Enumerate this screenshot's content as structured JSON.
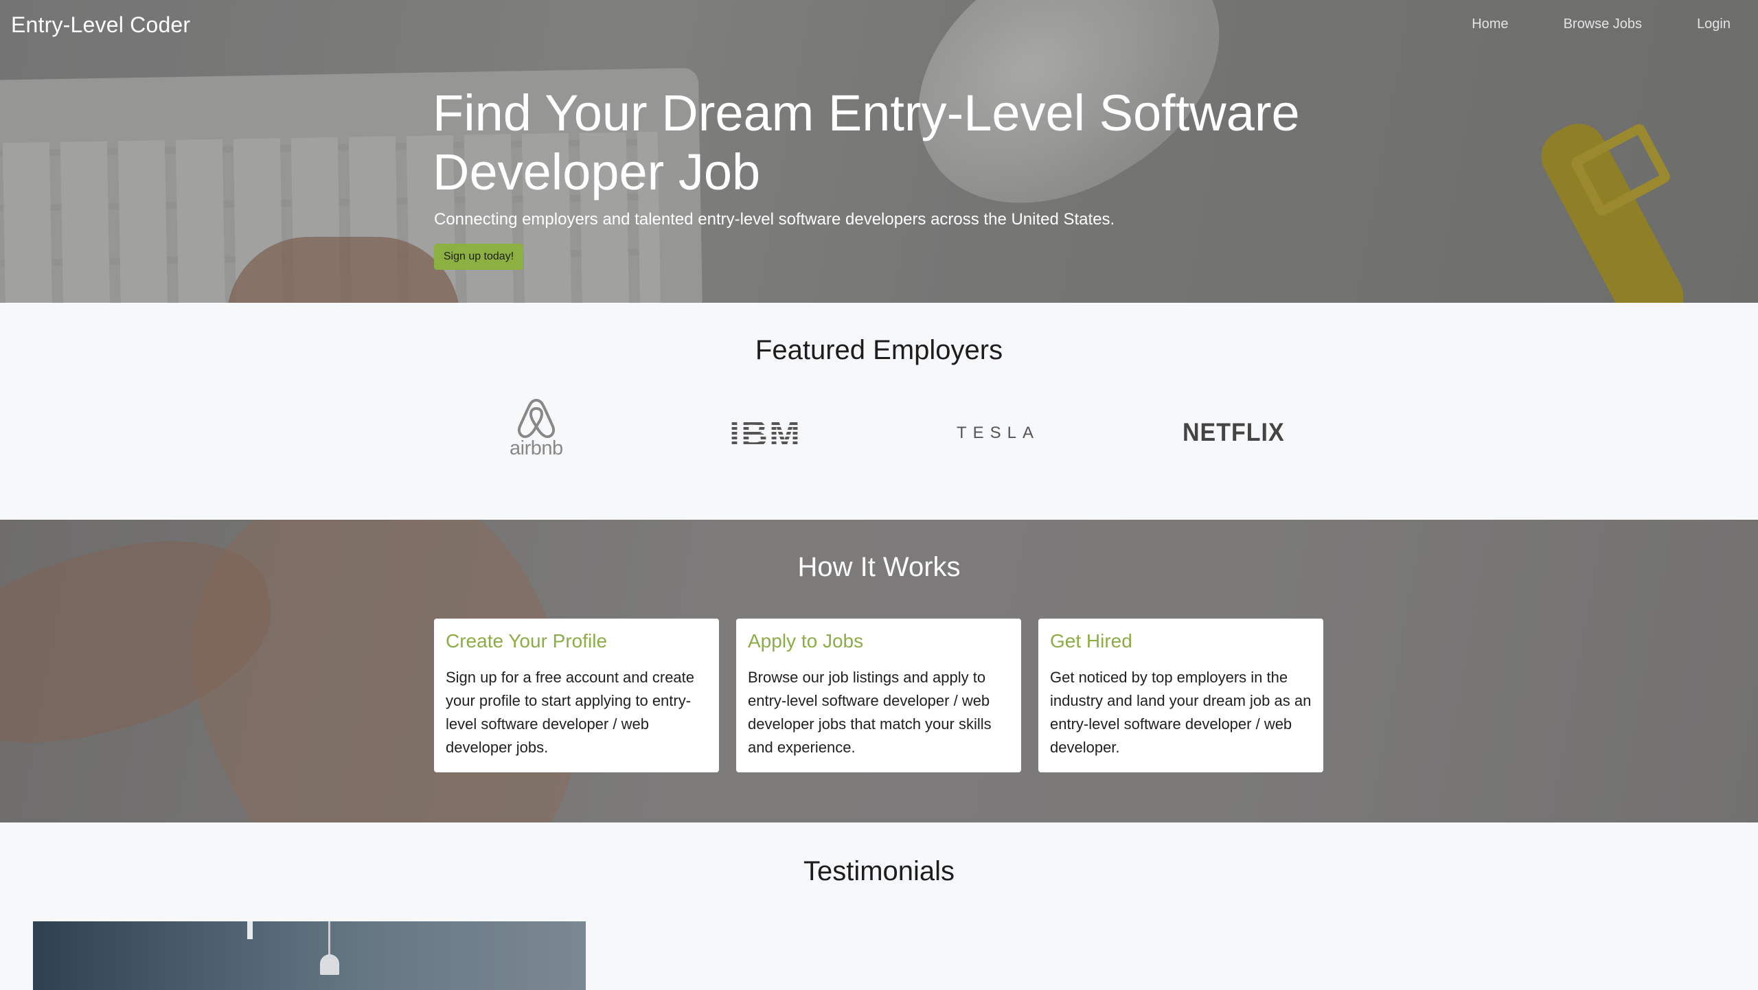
{
  "header": {
    "brand": "Entry-Level Coder",
    "nav": [
      "Home",
      "Browse Jobs",
      "Login"
    ]
  },
  "hero": {
    "title": "Find Your Dream Entry-Level Software Developer Job",
    "subtitle": "Connecting employers and talented entry-level software developers across the United States.",
    "cta_label": "Sign up today!",
    "accent_color": "#8db043"
  },
  "employers": {
    "title": "Featured Employers",
    "logos": [
      {
        "name": "airbnb",
        "icon": "airbnb-logo"
      },
      {
        "name": "IBM",
        "icon": "ibm-logo"
      },
      {
        "name": "TESLA",
        "icon": "tesla-logo"
      },
      {
        "name": "NETFLIX",
        "icon": "netflix-logo"
      }
    ]
  },
  "how_it_works": {
    "title": "How It Works",
    "cards": [
      {
        "title": "Create Your Profile",
        "body": "Sign up for a free account and create your profile to start applying to entry-level software developer / web developer jobs."
      },
      {
        "title": "Apply to Jobs",
        "body": "Browse our job listings and apply to entry-level software developer / web developer jobs that match your skills and experience."
      },
      {
        "title": "Get Hired",
        "body": "Get noticed by top employers in the industry and land your dream job as an entry-level software developer / web developer."
      }
    ],
    "card_title_color": "#8cad45"
  },
  "testimonials": {
    "title": "Testimonials"
  }
}
